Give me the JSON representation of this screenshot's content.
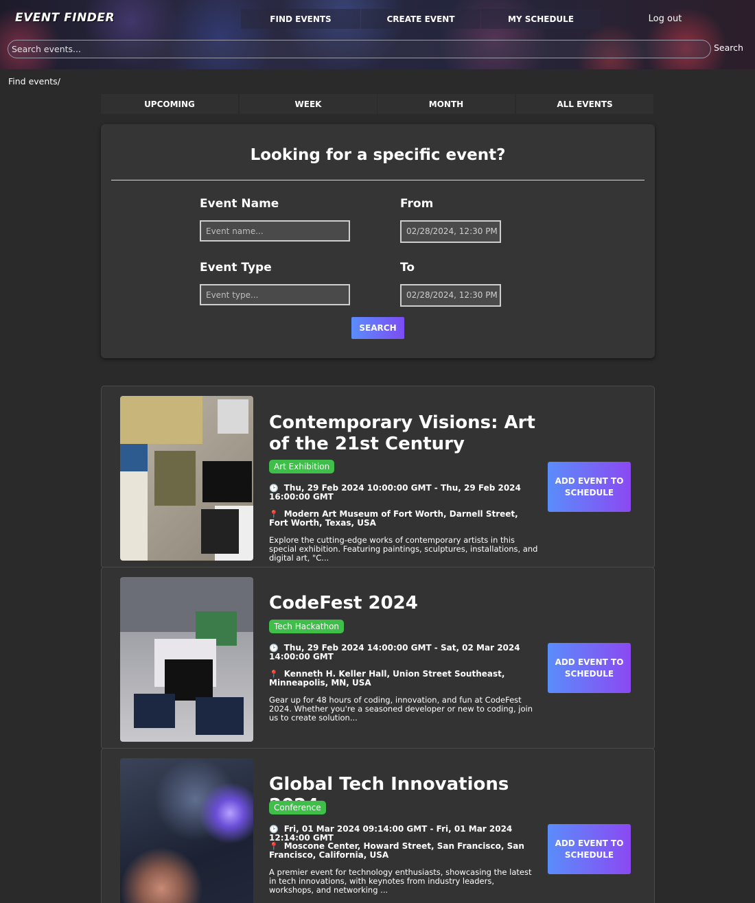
{
  "header": {
    "logo": "EVENT FINDER",
    "nav": [
      "FIND EVENTS",
      "CREATE EVENT",
      "MY SCHEDULE"
    ],
    "logout": "Log out",
    "search_placeholder": "Search events...",
    "search_button": "Search"
  },
  "breadcrumb": "Find events/",
  "tabs": [
    "UPCOMING",
    "WEEK",
    "MONTH",
    "ALL EVENTS"
  ],
  "search_panel": {
    "title": "Looking for a specific event?",
    "name_label": "Event Name",
    "name_placeholder": "Event name...",
    "from_label": "From",
    "from_value": "02/28/2024, 12:30 PM",
    "type_label": "Event Type",
    "type_placeholder": "Event type...",
    "to_label": "To",
    "to_value": "02/28/2024, 12:30 PM",
    "search_button": "SEARCH"
  },
  "events": [
    {
      "title": "Contemporary Visions: Art of the 21st Century",
      "type": "Art Exhibition",
      "datetime": "Thu, 29 Feb 2024 10:00:00 GMT - Thu, 29 Feb 2024 16:00:00 GMT",
      "location": "Modern Art Museum of Fort Worth, Darnell Street, Fort Worth, Texas, USA",
      "description": "Explore the cutting-edge works of contemporary artists in this special exhibition. Featuring paintings, sculptures, installations, and digital art, \"C...",
      "button": "ADD EVENT TO SCHEDULE"
    },
    {
      "title": "CodeFest 2024",
      "type": "Tech Hackathon",
      "datetime": "Thu, 29 Feb 2024 14:00:00 GMT - Sat, 02 Mar 2024 14:00:00 GMT",
      "location": "Kenneth H. Keller Hall, Union Street Southeast, Minneapolis, MN, USA",
      "description": "Gear up for 48 hours of coding, innovation, and fun at CodeFest 2024. Whether you're a seasoned developer or new to coding, join us to create solution...",
      "button": "ADD EVENT TO SCHEDULE"
    },
    {
      "title": "Global Tech Innovations 2024",
      "type": "Conference",
      "datetime": "Fri, 01 Mar 2024 09:14:00 GMT - Fri, 01 Mar 2024 12:14:00 GMT",
      "location": "Moscone Center, Howard Street, San Francisco, San Francisco, California, USA",
      "description": "A premier event for technology enthusiasts, showcasing the latest in tech innovations, with keynotes from industry leaders, workshops, and networking ...",
      "button": "ADD EVENT TO SCHEDULE"
    }
  ],
  "icons": {
    "clock": "clock-icon",
    "pin": "map-pin-icon"
  },
  "colors": {
    "accent_start": "#5a8dfb",
    "accent_end": "#8b49f2",
    "badge": "#3fbf4a",
    "background": "#2a2a2a"
  }
}
